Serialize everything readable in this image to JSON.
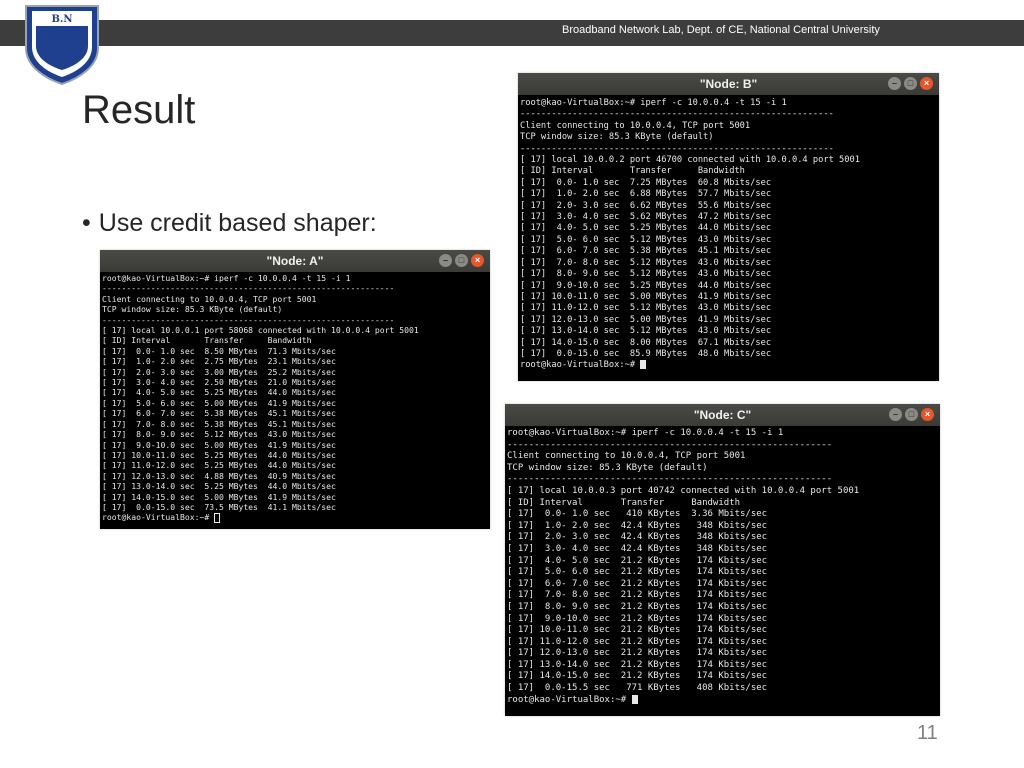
{
  "header": {
    "org_text": "Broadband Network Lab, Dept. of CE, National Central University",
    "logo": {
      "line1": "B.N",
      "line2": "BnLab"
    }
  },
  "slide": {
    "title": "Result",
    "bullet": "Use credit based shaper:",
    "page_number": "11"
  },
  "terminals": [
    {
      "title": "\"Node: A\"",
      "lines": [
        "root@kao-VirtualBox:~# iperf -c 10.0.0.4 -t 15 -i 1",
        "------------------------------------------------------------",
        "Client connecting to 10.0.0.4, TCP port 5001",
        "TCP window size: 85.3 KByte (default)",
        "------------------------------------------------------------",
        "[ 17] local 10.0.0.1 port 58068 connected with 10.0.0.4 port 5001",
        "[ ID] Interval       Transfer     Bandwidth",
        "[ 17]  0.0- 1.0 sec  8.50 MBytes  71.3 Mbits/sec",
        "[ 17]  1.0- 2.0 sec  2.75 MBytes  23.1 Mbits/sec",
        "[ 17]  2.0- 3.0 sec  3.00 MBytes  25.2 Mbits/sec",
        "[ 17]  3.0- 4.0 sec  2.50 MBytes  21.0 Mbits/sec",
        "[ 17]  4.0- 5.0 sec  5.25 MBytes  44.0 Mbits/sec",
        "[ 17]  5.0- 6.0 sec  5.00 MBytes  41.9 Mbits/sec",
        "[ 17]  6.0- 7.0 sec  5.38 MBytes  45.1 Mbits/sec",
        "[ 17]  7.0- 8.0 sec  5.38 MBytes  45.1 Mbits/sec",
        "[ 17]  8.0- 9.0 sec  5.12 MBytes  43.0 Mbits/sec",
        "[ 17]  9.0-10.0 sec  5.00 MBytes  41.9 Mbits/sec",
        "[ 17] 10.0-11.0 sec  5.25 MBytes  44.0 Mbits/sec",
        "[ 17] 11.0-12.0 sec  5.25 MBytes  44.0 Mbits/sec",
        "[ 17] 12.0-13.0 sec  4.88 MBytes  40.9 Mbits/sec",
        "[ 17] 13.0-14.0 sec  5.25 MBytes  44.0 Mbits/sec",
        "[ 17] 14.0-15.0 sec  5.00 MBytes  41.9 Mbits/sec",
        "[ 17]  0.0-15.0 sec  73.5 MBytes  41.1 Mbits/sec"
      ],
      "prompt": "root@kao-VirtualBox:~# "
    },
    {
      "title": "\"Node: B\"",
      "lines": [
        "root@kao-VirtualBox:~# iperf -c 10.0.0.4 -t 15 -i 1",
        "------------------------------------------------------------",
        "Client connecting to 10.0.0.4, TCP port 5001",
        "TCP window size: 85.3 KByte (default)",
        "------------------------------------------------------------",
        "[ 17] local 10.0.0.2 port 46700 connected with 10.0.0.4 port 5001",
        "[ ID] Interval       Transfer     Bandwidth",
        "[ 17]  0.0- 1.0 sec  7.25 MBytes  60.8 Mbits/sec",
        "[ 17]  1.0- 2.0 sec  6.88 MBytes  57.7 Mbits/sec",
        "[ 17]  2.0- 3.0 sec  6.62 MBytes  55.6 Mbits/sec",
        "[ 17]  3.0- 4.0 sec  5.62 MBytes  47.2 Mbits/sec",
        "[ 17]  4.0- 5.0 sec  5.25 MBytes  44.0 Mbits/sec",
        "[ 17]  5.0- 6.0 sec  5.12 MBytes  43.0 Mbits/sec",
        "[ 17]  6.0- 7.0 sec  5.38 MBytes  45.1 Mbits/sec",
        "[ 17]  7.0- 8.0 sec  5.12 MBytes  43.0 Mbits/sec",
        "[ 17]  8.0- 9.0 sec  5.12 MBytes  43.0 Mbits/sec",
        "[ 17]  9.0-10.0 sec  5.25 MBytes  44.0 Mbits/sec",
        "[ 17] 10.0-11.0 sec  5.00 MBytes  41.9 Mbits/sec",
        "[ 17] 11.0-12.0 sec  5.12 MBytes  43.0 Mbits/sec",
        "[ 17] 12.0-13.0 sec  5.00 MBytes  41.9 Mbits/sec",
        "[ 17] 13.0-14.0 sec  5.12 MBytes  43.0 Mbits/sec",
        "[ 17] 14.0-15.0 sec  8.00 MBytes  67.1 Mbits/sec",
        "[ 17]  0.0-15.0 sec  85.9 MBytes  48.0 Mbits/sec"
      ],
      "prompt": "root@kao-VirtualBox:~# "
    },
    {
      "title": "\"Node: C\"",
      "lines": [
        "root@kao-VirtualBox:~# iperf -c 10.0.0.4 -t 15 -i 1",
        "------------------------------------------------------------",
        "Client connecting to 10.0.0.4, TCP port 5001",
        "TCP window size: 85.3 KByte (default)",
        "------------------------------------------------------------",
        "[ 17] local 10.0.0.3 port 40742 connected with 10.0.0.4 port 5001",
        "[ ID] Interval       Transfer     Bandwidth",
        "[ 17]  0.0- 1.0 sec   410 KBytes  3.36 Mbits/sec",
        "[ 17]  1.0- 2.0 sec  42.4 KBytes   348 Kbits/sec",
        "[ 17]  2.0- 3.0 sec  42.4 KBytes   348 Kbits/sec",
        "[ 17]  3.0- 4.0 sec  42.4 KBytes   348 Kbits/sec",
        "[ 17]  4.0- 5.0 sec  21.2 KBytes   174 Kbits/sec",
        "[ 17]  5.0- 6.0 sec  21.2 KBytes   174 Kbits/sec",
        "[ 17]  6.0- 7.0 sec  21.2 KBytes   174 Kbits/sec",
        "[ 17]  7.0- 8.0 sec  21.2 KBytes   174 Kbits/sec",
        "[ 17]  8.0- 9.0 sec  21.2 KBytes   174 Kbits/sec",
        "[ 17]  9.0-10.0 sec  21.2 KBytes   174 Kbits/sec",
        "[ 17] 10.0-11.0 sec  21.2 KBytes   174 Kbits/sec",
        "[ 17] 11.0-12.0 sec  21.2 KBytes   174 Kbits/sec",
        "[ 17] 12.0-13.0 sec  21.2 KBytes   174 Kbits/sec",
        "[ 17] 13.0-14.0 sec  21.2 KBytes   174 Kbits/sec",
        "[ 17] 14.0-15.0 sec  21.2 KBytes   174 Kbits/sec",
        "[ 17]  0.0-15.5 sec   771 KBytes   408 Kbits/sec"
      ],
      "prompt": "root@kao-VirtualBox:~# "
    }
  ],
  "window_buttons": {
    "minimize": "–",
    "maximize": "□",
    "close": "×"
  },
  "colors": {
    "topbar": "#3d3d3d",
    "terminal_bg": "#000000",
    "terminal_text": "#e8e8e8",
    "close_button": "#e8562a",
    "logo_blue": "#1f3f8f"
  }
}
